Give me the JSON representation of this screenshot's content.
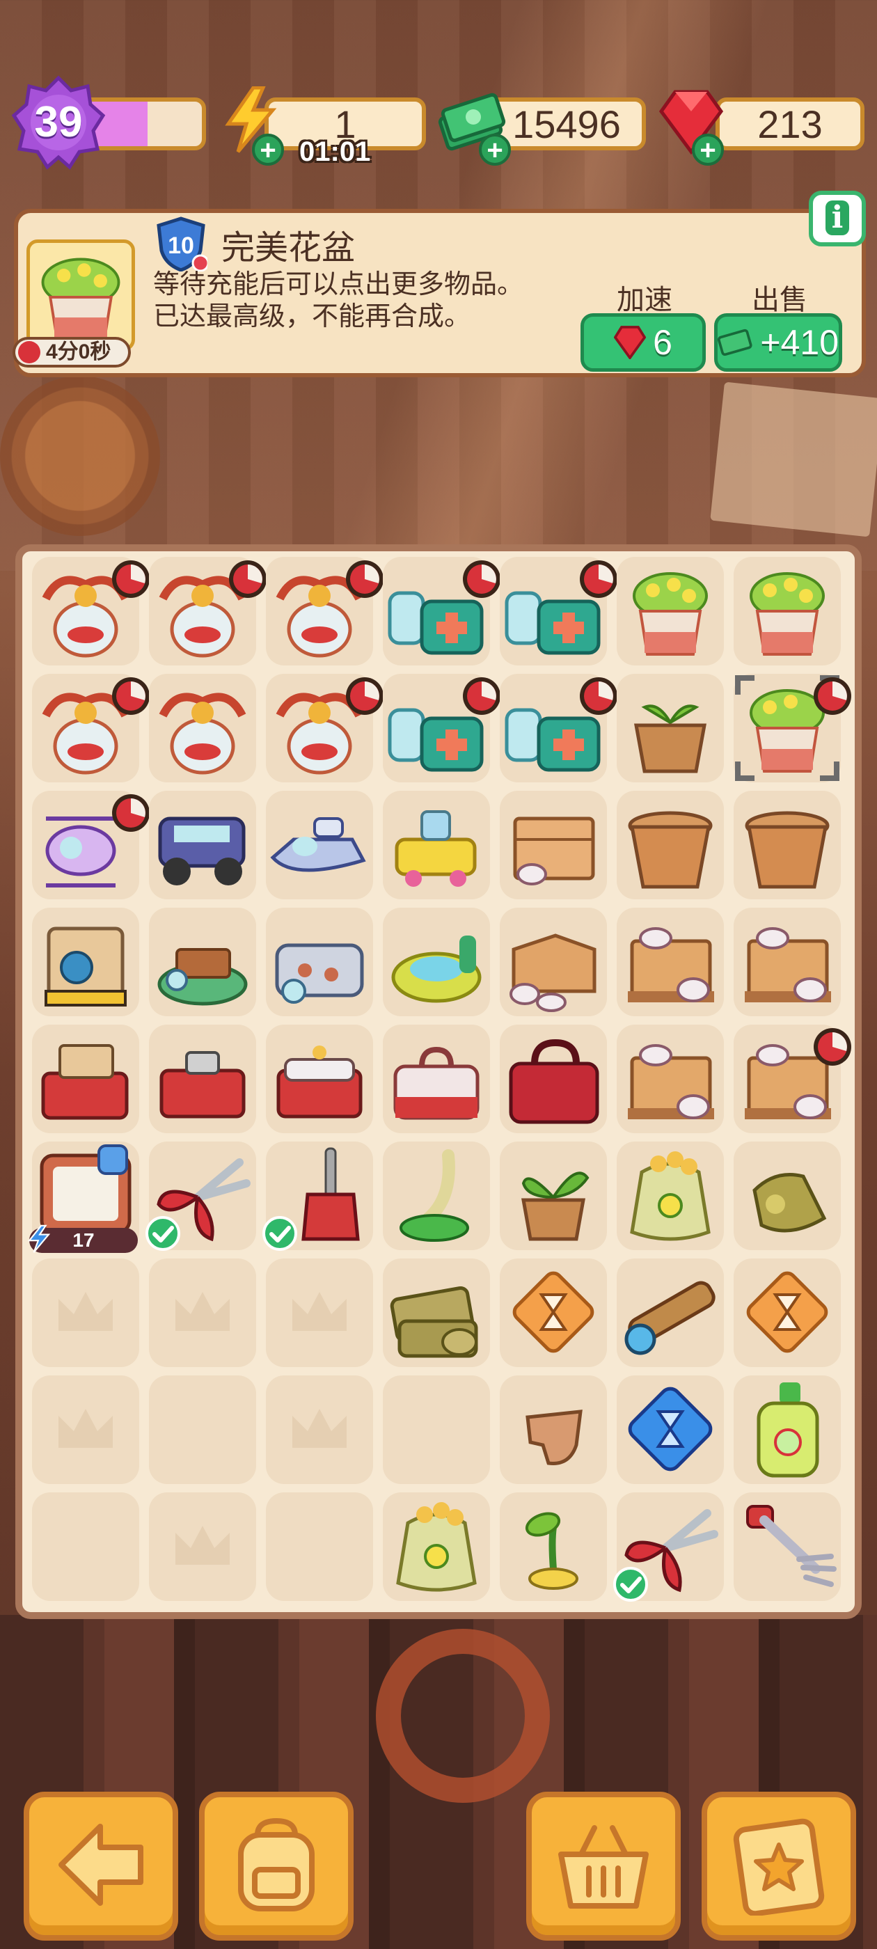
{
  "hud": {
    "level": "39",
    "xp_progress": 0.55,
    "energy": "1",
    "energy_timer": "01:01",
    "cash": "15496",
    "gems": "213"
  },
  "selected_item": {
    "level": "10",
    "name": "完美花盆",
    "description_line1": "等待充能后可以点出更多物品。",
    "description_line2": "已达最高级，不能再合成。",
    "timer": "4分0秒",
    "speedup_label": "加速",
    "speedup_cost": "6",
    "sell_label": "出售",
    "sell_value": "+410"
  },
  "board": {
    "columns": 7,
    "rows": 9,
    "items": [
      [
        "dragon-vase-icon",
        "dragon-vase-icon",
        "dragon-vase-icon",
        "medicine-kit-icon",
        "medicine-kit-icon",
        "flower-pot-icon",
        "flower-pot-icon"
      ],
      [
        "dragon-vase-icon",
        "dragon-vase-icon",
        "dragon-vase-icon",
        "medicine-kit-icon",
        "medicine-kit-icon",
        "sprout-pot-icon",
        "flower-pot-selected-icon"
      ],
      [
        "helicopter-icon",
        "jeep-icon",
        "jet-ski-icon",
        "cart-icon",
        "crate-cups-icon",
        "clay-pot-icon",
        "clay-pot-icon"
      ],
      [
        "safe-icon",
        "bench-icon",
        "pet-bed-icon",
        "fountain-icon",
        "box-cups-icon",
        "pallet-cups-icon",
        "pallet-cups-icon"
      ],
      [
        "toolbox-open-icon",
        "toolbox-red-icon",
        "toolbox-white-icon",
        "toolbox-closed-icon",
        "toolbox-big-icon",
        "pallet-cups-icon",
        "pallet-cups-icon"
      ],
      [
        "tablet-energy-icon",
        "pruning-shears-icon",
        "broom-icon",
        "slime-trowel-icon",
        "potted-plant-icon",
        "seed-sack-icon",
        "seed-bag-small-icon"
      ],
      [
        "empty",
        "empty",
        "empty",
        "sack-pile-icon",
        "hourglass-tile-icon",
        "spyglass-icon",
        "hourglass-tile-icon"
      ],
      [
        "empty",
        "empty",
        "empty",
        "empty",
        "broken-pot-icon",
        "blue-hourglass-gem-icon",
        "lotion-bottle-icon"
      ],
      [
        "empty",
        "empty",
        "empty",
        "seed-sack-icon",
        "seedling-icon",
        "pruning-shears-icon",
        "rake-icon"
      ]
    ],
    "timer_badges": [
      "0-0",
      "0-1",
      "0-2",
      "0-3",
      "0-4",
      "1-0",
      "1-2",
      "1-3",
      "1-4",
      "1-6",
      "2-0",
      "4-6"
    ],
    "check_badges": [
      "5-1",
      "5-2",
      "8-5"
    ],
    "crown_cells": [
      "6-0",
      "6-1",
      "6-2",
      "7-0",
      "7-2",
      "8-1"
    ],
    "energy_item_count": "17"
  },
  "bottom_bar": {
    "buttons": [
      "back-arrow-icon",
      "backpack-icon",
      "basket-icon",
      "clipboard-star-icon"
    ]
  }
}
